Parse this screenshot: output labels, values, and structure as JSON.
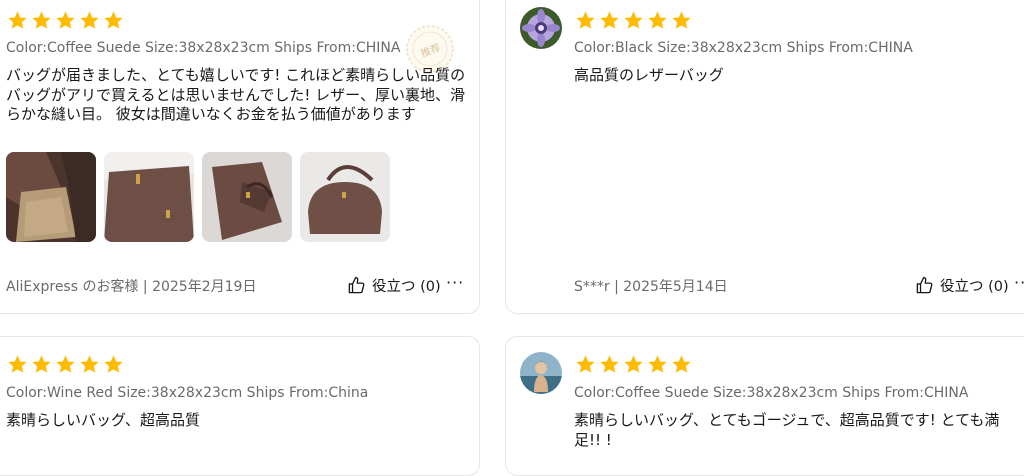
{
  "reviews": [
    {
      "rating": 5,
      "spec": "Color:Coffee Suede Size:38x28x23cm Ships From:CHINA",
      "text": "バッグが届きました、とても嬉しいです! これほど素晴らしい品質のバッグがアリで買えるとは思いませんでした! レザー、厚い裏地、滑らかな縫い目。 彼女は間違いなくお金を払う価値があります",
      "badge": "推荐",
      "photos": [
        "photo-1",
        "photo-2",
        "photo-3",
        "photo-4"
      ],
      "author_date": "AliExpress のお客様 | 2025年2月19日",
      "helpful": "役立つ (0)",
      "more": "···"
    },
    {
      "rating": 5,
      "spec": "Color:Black Size:38x28x23cm Ships From:CHINA",
      "text": "高品質のレザーバッグ",
      "author_date": "S***r | 2025年5月14日",
      "helpful": "役立つ (0)",
      "more": "···"
    },
    {
      "rating": 5,
      "spec": "Color:Wine Red Size:38x28x23cm Ships From:China",
      "text": "素晴らしいバッグ、超高品質"
    },
    {
      "rating": 5,
      "spec": "Color:Coffee Suede Size:38x28x23cm Ships From:CHINA",
      "text": "素晴らしいバッグ、とてもゴージュで、超高品質です! とても満足!! !"
    }
  ],
  "colors": {
    "star": "#ffbb00",
    "text": "#191919",
    "muted": "#6a6a6a",
    "border": "#e6e6e6"
  },
  "icons": {
    "star": "star-icon",
    "helpful": "thumbs-up-icon",
    "more": "more-icon"
  }
}
